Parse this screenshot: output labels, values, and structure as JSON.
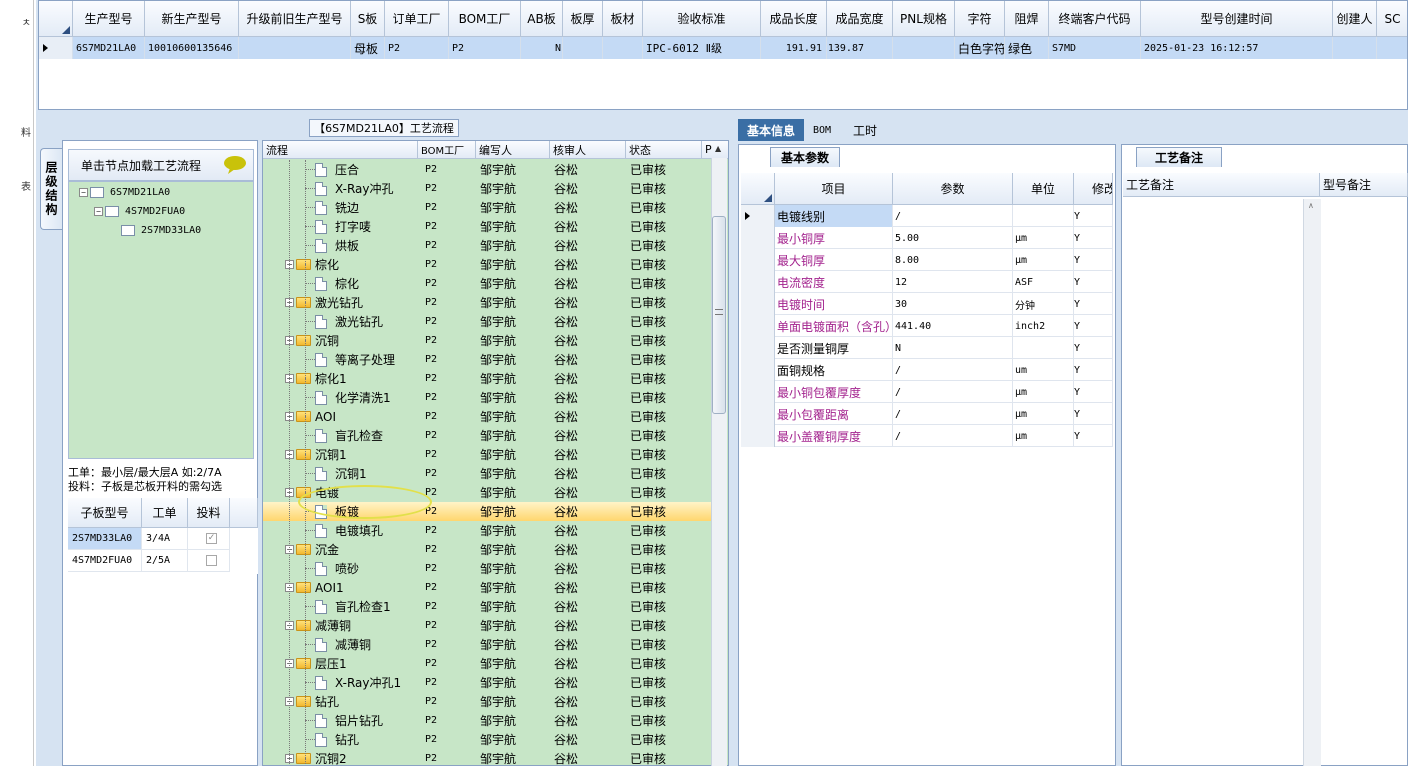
{
  "left_strip": {
    "chars": [
      "ㅊ",
      "料",
      "表"
    ]
  },
  "top_grid": {
    "columns": [
      "生产型号",
      "新生产型号",
      "升级前旧生产型号",
      "S板",
      "订单工厂",
      "BOM工厂",
      "AB板",
      "板厚",
      "板材",
      "验收标准",
      "成品长度",
      "成品宽度",
      "PNL规格",
      "字符",
      "阻焊",
      "终端客户代码",
      "型号创建时间",
      "创建人",
      "SC"
    ],
    "row": [
      "6S7MD21LA0",
      "10010600135646",
      "",
      "母板",
      "P2",
      "P2",
      "N",
      "",
      "",
      "IPC-6012 Ⅱ级",
      "191.91",
      "139.87",
      "",
      "白色字符",
      "绿色",
      "S7MD",
      "2025-01-23 16:12:57",
      "",
      ""
    ]
  },
  "left_panel": {
    "vertical_tab": "层级结构",
    "tree_header": "单击节点加载工艺流程",
    "tree": [
      {
        "label": "6S7MD21LA0",
        "level": 0
      },
      {
        "label": "4S7MD2FUA0",
        "level": 1
      },
      {
        "label": "2S7MD33LA0",
        "level": 2
      }
    ],
    "info_line1": "工单：最小层/最大层A 如:2/7A",
    "info_line2": "投料：子板是芯板开料的需勾选",
    "sub_grid": {
      "columns": [
        "子板型号",
        "工单",
        "投料"
      ],
      "rows": [
        {
          "model": "2S7MD33LA0",
          "order": "3/4A",
          "checked": true
        },
        {
          "model": "4S7MD2FUA0",
          "order": "2/5A",
          "checked": false
        }
      ]
    }
  },
  "flow": {
    "label": "【6S7MD21LA0】工艺流程",
    "columns": [
      "流程",
      "BOM工厂",
      "编写人",
      "核审人",
      "状态",
      "P"
    ],
    "rows": [
      {
        "name": "压合",
        "type": "doc",
        "bom": "P2",
        "writer": "邹宇航",
        "reviewer": "谷松",
        "status": "已审核"
      },
      {
        "name": "X-Ray冲孔",
        "type": "doc",
        "bom": "P2",
        "writer": "邹宇航",
        "reviewer": "谷松",
        "status": "已审核"
      },
      {
        "name": "铣边",
        "type": "doc",
        "bom": "P2",
        "writer": "邹宇航",
        "reviewer": "谷松",
        "status": "已审核"
      },
      {
        "name": "打字唛",
        "type": "doc",
        "bom": "P2",
        "writer": "邹宇航",
        "reviewer": "谷松",
        "status": "已审核"
      },
      {
        "name": "烘板",
        "type": "doc",
        "bom": "P2",
        "writer": "邹宇航",
        "reviewer": "谷松",
        "status": "已审核"
      },
      {
        "name": "棕化",
        "type": "folder",
        "bom": "P2",
        "writer": "邹宇航",
        "reviewer": "谷松",
        "status": "已审核"
      },
      {
        "name": "棕化",
        "type": "doc",
        "bom": "P2",
        "writer": "邹宇航",
        "reviewer": "谷松",
        "status": "已审核"
      },
      {
        "name": "激光钻孔",
        "type": "folder",
        "bom": "P2",
        "writer": "邹宇航",
        "reviewer": "谷松",
        "status": "已审核"
      },
      {
        "name": "激光钻孔",
        "type": "doc",
        "bom": "P2",
        "writer": "邹宇航",
        "reviewer": "谷松",
        "status": "已审核"
      },
      {
        "name": "沉铜",
        "type": "folder",
        "bom": "P2",
        "writer": "邹宇航",
        "reviewer": "谷松",
        "status": "已审核"
      },
      {
        "name": "等离子处理",
        "type": "doc",
        "bom": "P2",
        "writer": "邹宇航",
        "reviewer": "谷松",
        "status": "已审核"
      },
      {
        "name": "棕化1",
        "type": "folder",
        "bom": "P2",
        "writer": "邹宇航",
        "reviewer": "谷松",
        "status": "已审核"
      },
      {
        "name": "化学清洗1",
        "type": "doc",
        "bom": "P2",
        "writer": "邹宇航",
        "reviewer": "谷松",
        "status": "已审核"
      },
      {
        "name": "AOI",
        "type": "folder",
        "bom": "P2",
        "writer": "邹宇航",
        "reviewer": "谷松",
        "status": "已审核"
      },
      {
        "name": "盲孔检查",
        "type": "doc",
        "bom": "P2",
        "writer": "邹宇航",
        "reviewer": "谷松",
        "status": "已审核"
      },
      {
        "name": "沉铜1",
        "type": "folder",
        "bom": "P2",
        "writer": "邹宇航",
        "reviewer": "谷松",
        "status": "已审核"
      },
      {
        "name": "沉铜1",
        "type": "doc",
        "bom": "P2",
        "writer": "邹宇航",
        "reviewer": "谷松",
        "status": "已审核"
      },
      {
        "name": "电镀",
        "type": "folder",
        "bom": "P2",
        "writer": "邹宇航",
        "reviewer": "谷松",
        "status": "已审核"
      },
      {
        "name": "板镀",
        "type": "doc",
        "bom": "P2",
        "writer": "邹宇航",
        "reviewer": "谷松",
        "status": "已审核",
        "selected": true
      },
      {
        "name": "电镀填孔",
        "type": "doc",
        "bom": "P2",
        "writer": "邹宇航",
        "reviewer": "谷松",
        "status": "已审核"
      },
      {
        "name": "沉金",
        "type": "folder",
        "bom": "P2",
        "writer": "邹宇航",
        "reviewer": "谷松",
        "status": "已审核"
      },
      {
        "name": "喷砂",
        "type": "doc",
        "bom": "P2",
        "writer": "邹宇航",
        "reviewer": "谷松",
        "status": "已审核"
      },
      {
        "name": "AOI1",
        "type": "folder",
        "bom": "P2",
        "writer": "邹宇航",
        "reviewer": "谷松",
        "status": "已审核"
      },
      {
        "name": "盲孔检查1",
        "type": "doc",
        "bom": "P2",
        "writer": "邹宇航",
        "reviewer": "谷松",
        "status": "已审核"
      },
      {
        "name": "减薄铜",
        "type": "folder",
        "bom": "P2",
        "writer": "邹宇航",
        "reviewer": "谷松",
        "status": "已审核"
      },
      {
        "name": "减薄铜",
        "type": "doc",
        "bom": "P2",
        "writer": "邹宇航",
        "reviewer": "谷松",
        "status": "已审核"
      },
      {
        "name": "层压1",
        "type": "folder",
        "bom": "P2",
        "writer": "邹宇航",
        "reviewer": "谷松",
        "status": "已审核"
      },
      {
        "name": "X-Ray冲孔1",
        "type": "doc",
        "bom": "P2",
        "writer": "邹宇航",
        "reviewer": "谷松",
        "status": "已审核"
      },
      {
        "name": "钻孔",
        "type": "folder",
        "bom": "P2",
        "writer": "邹宇航",
        "reviewer": "谷松",
        "status": "已审核"
      },
      {
        "name": "铝片钻孔",
        "type": "doc",
        "bom": "P2",
        "writer": "邹宇航",
        "reviewer": "谷松",
        "status": "已审核"
      },
      {
        "name": "钻孔",
        "type": "doc",
        "bom": "P2",
        "writer": "邹宇航",
        "reviewer": "谷松",
        "status": "已审核"
      },
      {
        "name": "沉铜2",
        "type": "folder",
        "bom": "P2",
        "writer": "邹宇航",
        "reviewer": "谷松",
        "status": "已审核"
      }
    ]
  },
  "right_tabs": [
    "基本信息",
    "BOM",
    "工时"
  ],
  "basic_params": {
    "tab": "基本参数",
    "columns": [
      "项目",
      "参数",
      "单位",
      "修改"
    ],
    "rows": [
      {
        "item": "电镀线别",
        "value": "/",
        "unit": "",
        "mod": "Y",
        "color": "#000000"
      },
      {
        "item": "最小铜厚",
        "value": "5.00",
        "unit": "μm",
        "mod": "Y",
        "color": "#a3238e"
      },
      {
        "item": "最大铜厚",
        "value": "8.00",
        "unit": "μm",
        "mod": "Y",
        "color": "#a3238e"
      },
      {
        "item": "电流密度",
        "value": "12",
        "unit": "ASF",
        "mod": "Y",
        "color": "#a3238e"
      },
      {
        "item": "电镀时间",
        "value": "30",
        "unit": "分钟",
        "mod": "Y",
        "color": "#a3238e"
      },
      {
        "item": "单面电镀面积（含孔）",
        "value": "441.40",
        "unit": "inch2",
        "mod": "Y",
        "color": "#a3238e"
      },
      {
        "item": "是否测量铜厚",
        "value": "N",
        "unit": "",
        "mod": "Y",
        "color": "#000000"
      },
      {
        "item": "面铜规格",
        "value": "/",
        "unit": "um",
        "mod": "Y",
        "color": "#000000"
      },
      {
        "item": "最小铜包覆厚度",
        "value": "/",
        "unit": "μm",
        "mod": "Y",
        "color": "#a3238e"
      },
      {
        "item": "最小包覆距离",
        "value": "/",
        "unit": "μm",
        "mod": "Y",
        "color": "#a3238e"
      },
      {
        "item": "最小盖覆铜厚度",
        "value": "/",
        "unit": "μm",
        "mod": "Y",
        "color": "#a3238e"
      }
    ]
  },
  "remarks": {
    "tab": "工艺备注",
    "columns": [
      "工艺备注",
      "型号备注"
    ]
  },
  "colors": {
    "accent": "#3a6ea5",
    "selection": "#c4daf5",
    "tree_bg": "#c7e6c7",
    "highlight": "#ffd66e"
  }
}
